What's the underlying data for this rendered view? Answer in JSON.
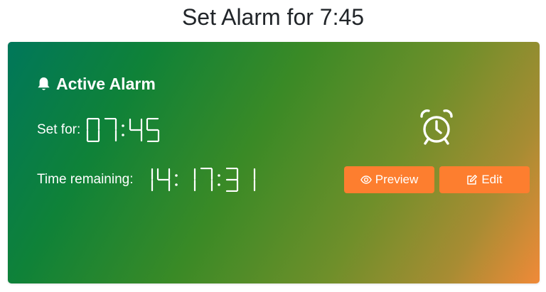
{
  "page": {
    "title": "Set Alarm for 7:45"
  },
  "alarm_card": {
    "header": "Active Alarm",
    "header_icon": "bell-icon",
    "set_for_label": "Set for:",
    "set_for_time": "07:45",
    "remaining_label": "Time remaining:",
    "remaining_time": "14:17:31",
    "alarm_icon": "alarm-clock-icon",
    "gradient_colors": [
      "#00775a",
      "#0f8238",
      "#3a8a26",
      "#6f8f2a",
      "#a88c33",
      "#f08a38"
    ]
  },
  "actions": {
    "preview_label": "Preview",
    "preview_icon": "eye-icon",
    "edit_label": "Edit",
    "edit_icon": "edit-icon",
    "button_color": "#fd7e2f"
  }
}
